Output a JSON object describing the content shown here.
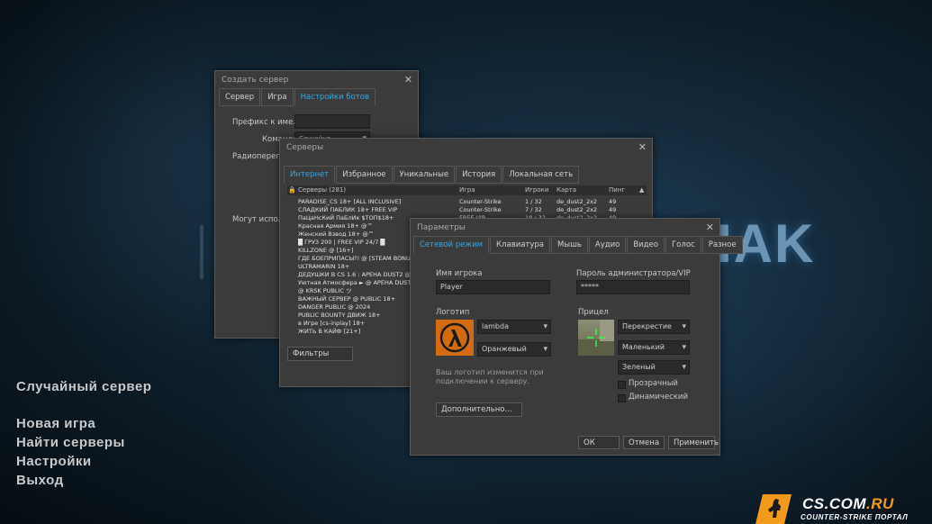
{
  "background_logo": "CHAK",
  "main_menu": {
    "random_server": "Случайный сервер",
    "new_game": "Новая игра",
    "find_servers": "Найти серверы",
    "settings": "Настройки",
    "exit": "Выход"
  },
  "create_server": {
    "title": "Создать сервер",
    "tabs": [
      "Сервер",
      "Игра",
      "Настройки ботов"
    ],
    "active_tab": "Настройки ботов",
    "labels": {
      "prefix": "Префикс к име...",
      "team": "Команда",
      "team_value": "Случайно",
      "radio": "Радиопереговор",
      "can_use": "Могут использ"
    }
  },
  "servers": {
    "title": "Серверы",
    "tabs": [
      "Интернет",
      "Избранное",
      "Уникальные",
      "История",
      "Локальная сеть"
    ],
    "active_tab": "Интернет",
    "columns": {
      "servers": "Серверы (281)",
      "game": "Игра",
      "players": "Игроки",
      "map": "Карта",
      "ping": "Пинг"
    },
    "rows": [
      {
        "name": "PARADISE_CS 18+ [ALL INCLUSIVE]",
        "game": "Counter-Strike",
        "players": "1 / 32",
        "map": "de_dust2_2x2",
        "ping": "49"
      },
      {
        "name": "СЛАДКИЙ ПАБЛИК 18+ FREE VIP",
        "game": "Counter-Strike",
        "players": "7 / 32",
        "map": "de_dust2_2x2",
        "ping": "49"
      },
      {
        "name": "ПаЦаНсКиЙ ПаБлИк $TOП$18+",
        "game": "FREE VIP",
        "players": "18 / 32",
        "map": "de_dust2_2x2",
        "ping": "49"
      },
      {
        "name": "Красная Армия 18+ @™",
        "game": "",
        "players": "",
        "map": "",
        "ping": ""
      },
      {
        "name": "Женский Взвод 18+ @™",
        "game": "",
        "players": "",
        "map": "",
        "ping": ""
      },
      {
        "name": "█ ГРУЗ 200 | FREE VIP 24/7 █",
        "game": "",
        "players": "",
        "map": "",
        "ping": ""
      },
      {
        "name": "KILLZONE @ [16+]",
        "game": "",
        "players": "",
        "map": "",
        "ping": ""
      },
      {
        "name": "ГДЕ БОЕПРИПАСЫ?! @ [STEAM BONUS]",
        "game": "",
        "players": "",
        "map": "",
        "ping": ""
      },
      {
        "name": "ULTRAMARIN 18+",
        "game": "",
        "players": "",
        "map": "",
        "ping": ""
      },
      {
        "name": "ДЕДУШКИ В CS 1.6 : АРЕНА DUST2 @™",
        "game": "",
        "players": "",
        "map": "",
        "ping": ""
      },
      {
        "name": "Уютная Атмосфера ► @ АРЕНА DUST2",
        "game": "",
        "players": "",
        "map": "",
        "ping": ""
      },
      {
        "name": "@ KRSK PUBLIC ツ",
        "game": "",
        "players": "",
        "map": "",
        "ping": ""
      },
      {
        "name": "ВАЖНЫЙ СЕРВЕР @ PUBLIC 18+",
        "game": "",
        "players": "",
        "map": "",
        "ping": ""
      },
      {
        "name": "DANGER PUBLIC @ 2024",
        "game": "",
        "players": "",
        "map": "",
        "ping": ""
      },
      {
        "name": "PUBLIC BOUNTY ДВИЖ 18+",
        "game": "",
        "players": "",
        "map": "",
        "ping": ""
      },
      {
        "name": "в Игре [cs-inplay] 18+",
        "game": "",
        "players": "",
        "map": "",
        "ping": ""
      },
      {
        "name": "ЖИТЬ В КАЙФ [21+]",
        "game": "",
        "players": "",
        "map": "",
        "ping": ""
      }
    ],
    "filters_button": "Фильтры"
  },
  "options": {
    "title": "Параметры",
    "tabs": [
      "Сетевой режим",
      "Клавиатура",
      "Мышь",
      "Аудио",
      "Видео",
      "Голос",
      "Разное"
    ],
    "active_tab": "Сетевой режим",
    "player_name_label": "Имя игрока",
    "player_name_value": "Player",
    "admin_password_label": "Пароль администратора/VIP",
    "admin_password_value": "*****",
    "logo_label": "Логотип",
    "logo_select": "lambda",
    "logo_color": "Оранжевый",
    "logo_note": "Ваш логотип изменится при подключении к серверу.",
    "crosshair_label": "Прицел",
    "crosshair_type": "Перекрестие",
    "crosshair_size": "Маленький",
    "crosshair_color": "Зеленый",
    "transparent_label": "Прозрачный",
    "dynamic_label": "Динамический",
    "advanced_button": "Дополнительно...",
    "ok_button": "ОК",
    "cancel_button": "Отмена",
    "apply_button": "Применить"
  },
  "brand": {
    "site_main": "CS.COM",
    "site_tld": ".RU",
    "subtitle": "COUNTER-STRIKE ПОРТАЛ"
  },
  "colors": {
    "accent_blue": "#3aa4e3",
    "logo_orange": "#d26a12",
    "brand_orange": "#f29a1c"
  }
}
